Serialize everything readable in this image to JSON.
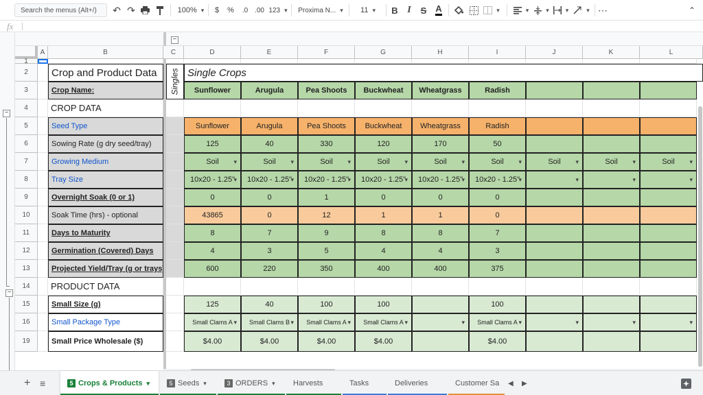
{
  "toolbar": {
    "search_placeholder": "Search the menus (Alt+/)",
    "zoom": "100%",
    "currency": "$",
    "percent": "%",
    "dec_decrease": ".0",
    "dec_increase": ".00",
    "more_formats": "123",
    "font": "Proxima N...",
    "font_size": "11",
    "bold": "B",
    "italic": "I",
    "strikethrough": "S",
    "text_color": "A",
    "more": "⋯",
    "icons": [
      "undo-icon",
      "redo-icon",
      "print-icon",
      "paint-format-icon",
      "fill-color-icon",
      "borders-icon",
      "merge-icon",
      "align-icon",
      "valign-icon",
      "wrap-icon",
      "rotate-icon"
    ]
  },
  "formula_bar": {
    "fx": "fx",
    "value": ""
  },
  "columns": [
    "A",
    "B",
    "C",
    "D",
    "E",
    "F",
    "G",
    "H",
    "I",
    "J",
    "K",
    "L"
  ],
  "rows": [
    "1",
    "2",
    "3",
    "4",
    "5",
    "6",
    "7",
    "8",
    "9",
    "10",
    "11",
    "12",
    "13",
    "14",
    "15",
    "16",
    "19"
  ],
  "sheet": {
    "title": "Crop and Product Data",
    "singles_label": "Singles",
    "single_crops": "Single Crops",
    "crop_name_label": "Crop Name:",
    "crops": [
      "Sunflower",
      "Arugula",
      "Pea Shoots",
      "Buckwheat",
      "Wheatgrass",
      "Radish"
    ],
    "crop_data_header": "CROP DATA",
    "product_data_header": "PRODUCT DATA",
    "labels": {
      "seed_type": "Seed Type",
      "sowing_rate": "Sowing Rate (g dry seed/tray)",
      "growing_medium": "Growing Medium",
      "tray_size": "Tray Size",
      "overnight_soak": "Overnight Soak (0 or 1)",
      "soak_time": "Soak Time (hrs) - optional",
      "days_to_maturity": "Days to Maturity",
      "germination": "Germination (Covered) Days",
      "projected_yield": "Projected Yield/Tray (g or trays)",
      "small_size": "Small Size (g)",
      "small_package": "Small Package Type",
      "small_price": "Small Price Wholesale ($)"
    },
    "seed_type": [
      "Sunflower",
      "Arugula",
      "Pea Shoots",
      "Buckwheat",
      "Wheatgrass",
      "Radish"
    ],
    "sowing_rate": [
      "125",
      "40",
      "330",
      "120",
      "170",
      "50"
    ],
    "growing_medium": [
      "Soil",
      "Soil",
      "Soil",
      "Soil",
      "Soil",
      "Soil",
      "Soil",
      "Soil",
      "Soil"
    ],
    "tray_size": [
      "10x20 - 1.25\"",
      "10x20 - 1.25\"",
      "10x20 - 1.25\"",
      "10x20 - 1.25\"",
      "10x20 - 1.25\"",
      "10x20 - 1.25\""
    ],
    "overnight_soak": [
      "0",
      "0",
      "1",
      "0",
      "0",
      "0"
    ],
    "soak_time": [
      "43865",
      "0",
      "12",
      "1",
      "1",
      "0"
    ],
    "days_to_maturity": [
      "8",
      "7",
      "9",
      "8",
      "8",
      "7"
    ],
    "germination": [
      "4",
      "3",
      "5",
      "4",
      "4",
      "3"
    ],
    "projected_yield": [
      "600",
      "220",
      "350",
      "400",
      "400",
      "375"
    ],
    "small_size": [
      "125",
      "40",
      "100",
      "100",
      "",
      "100"
    ],
    "small_package": [
      "Small Clams A",
      "Small Clams B",
      "Small Clams A",
      "Small Clams A",
      "",
      "Small Clams A"
    ],
    "small_price": [
      "$4.00",
      "$4.00",
      "$4.00",
      "$4.00",
      "",
      "$4.00"
    ]
  },
  "tabs": [
    {
      "num": "5",
      "label": "Crops & Products",
      "active": true,
      "color": "#188038"
    },
    {
      "num": "5",
      "label": "Seeds",
      "active": false,
      "color": "#188038"
    },
    {
      "num": "3",
      "label": "ORDERS",
      "active": false,
      "color": "#188038"
    },
    {
      "label": "Harvests",
      "active": false,
      "color": "#188038"
    },
    {
      "label": "Tasks",
      "active": false,
      "color": "#3c78d8"
    },
    {
      "label": "Deliveries",
      "active": false,
      "color": "#3c78d8"
    },
    {
      "label": "Customer Sa",
      "active": false,
      "color": "#e69138"
    }
  ],
  "tab_controls": {
    "add": "+",
    "all_sheets": "≡",
    "prev": "◀",
    "next": "▶"
  }
}
